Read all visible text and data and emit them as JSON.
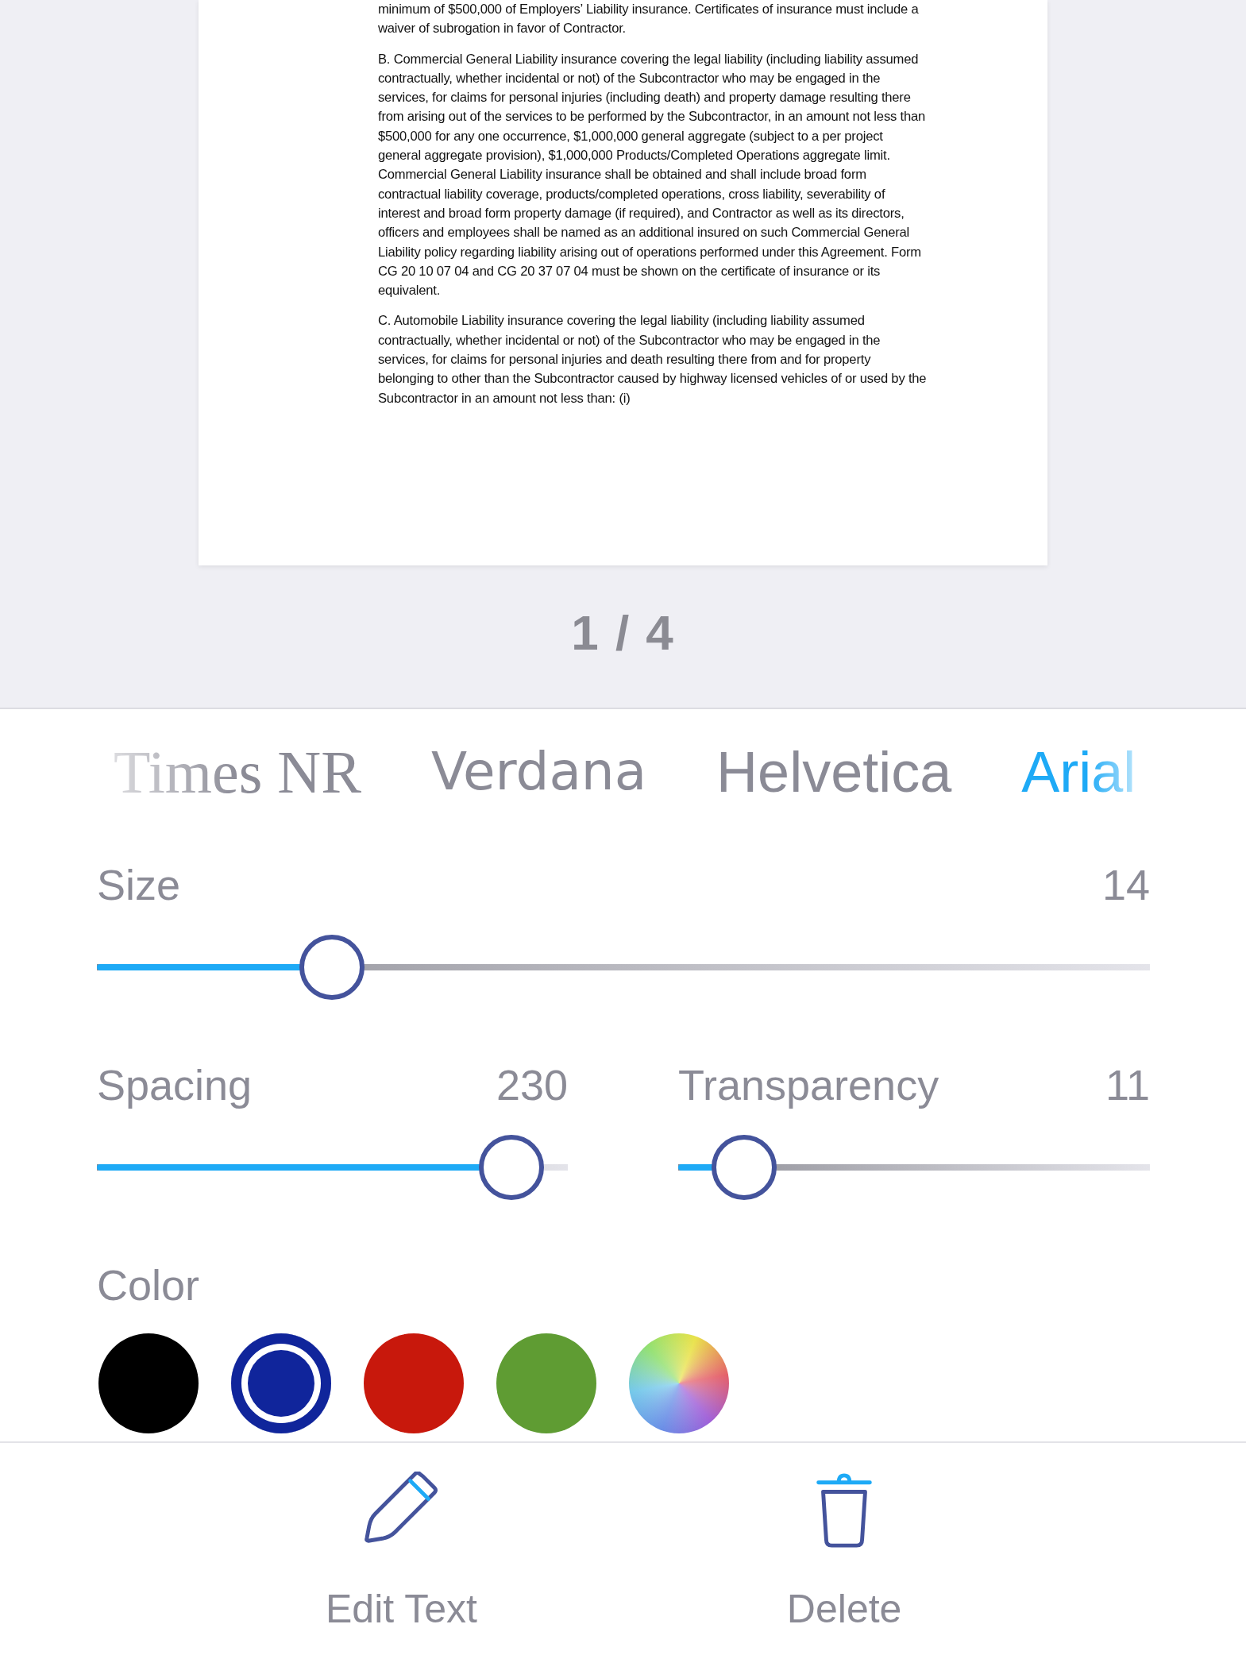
{
  "document": {
    "paragraphs": [
      "minimum of $500,000 of Employers’ Liability insurance. Certificates of insurance must include a waiver of subrogation in favor of Contractor.",
      "B. Commercial General Liability insurance covering the legal liability (including liability assumed contractually, whether incidental or not) of the Subcontractor who may be engaged in the services, for claims for personal injuries (including death) and property damage resulting there from arising out of the services to be performed by the Subcontractor, in an amount not less than $500,000 for any one occurrence, $1,000,000 general aggregate (subject to a per project general aggregate provision), $1,000,000 Products/Completed Operations aggregate limit. Commercial General Liability insurance shall be obtained and shall include broad form contractual liability coverage, products/completed operations, cross liability, severability of interest and broad form property damage (if required), and Contractor as well as its directors, officers and employees shall be named as an additional insured on such Commercial General Liability policy regarding liability arising out of operations performed under this Agreement. Form CG 20 10 07 04 and CG 20 37 07 04 must be shown on the certificate of insurance or its equivalent.",
      "C. Automobile Liability insurance covering the legal liability (including liability assumed contractually, whether incidental or not) of the Subcontractor who may be engaged in the services, for claims for personal injuries and death resulting there from and for property belonging to other than the Subcontractor caused by highway licensed vehicles of or used by the Subcontractor in an amount not less than: (i)"
    ]
  },
  "page_indicator": "1 / 4",
  "font_tabs": [
    {
      "label": "Times NR",
      "kind": "serif",
      "selected": false
    },
    {
      "label": "Verdana",
      "kind": "verdana",
      "selected": false
    },
    {
      "label": "Helvetica",
      "kind": "sans",
      "selected": false
    },
    {
      "label": "Arial",
      "kind": "sans",
      "selected": true
    }
  ],
  "sliders": [
    {
      "label": "Size",
      "value": "14",
      "level": 0.223
    },
    {
      "label": "Spacing",
      "value": "230",
      "level": 0.88
    },
    {
      "label": "Transparency",
      "value": "11",
      "level": 0.14
    }
  ],
  "color_section": {
    "label": "Color",
    "swatches": [
      {
        "kind": "solid",
        "color": "#000000",
        "selected": false
      },
      {
        "kind": "solid",
        "color": "#10259b",
        "selected": true
      },
      {
        "kind": "solid",
        "color": "#c8180c",
        "selected": false
      },
      {
        "kind": "solid",
        "color": "#5f9c33",
        "selected": false
      },
      {
        "kind": "spectrum",
        "selected": false
      }
    ]
  },
  "actions": [
    {
      "kind": "pencil",
      "label": "Edit Text"
    },
    {
      "kind": "trash",
      "label": "Delete"
    }
  ]
}
